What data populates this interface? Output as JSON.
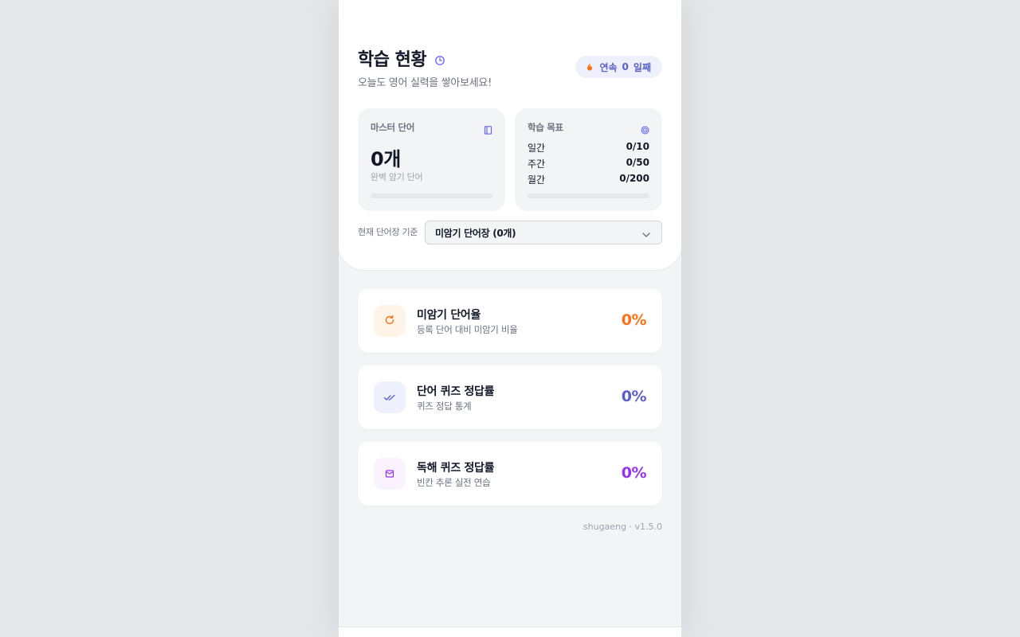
{
  "header": {
    "title": "학습 현황",
    "subtitle": "오늘도 영어 실력을 쌓아보세요!",
    "streak": {
      "label": "연속",
      "count": "0",
      "unit": "일째"
    }
  },
  "mastered": {
    "label": "마스터 단어",
    "value": "0개",
    "caption": "완벽 암기 단어",
    "progress": 0
  },
  "goals": {
    "label": "학습 목표",
    "rows": [
      {
        "name": "일간",
        "value": "0/10"
      },
      {
        "name": "주간",
        "value": "0/50"
      },
      {
        "name": "월간",
        "value": "0/200"
      }
    ],
    "progress": 0
  },
  "basis": {
    "label": "현재 단어장 기준",
    "selected": "미암기 단어장 (0개)"
  },
  "metrics": [
    {
      "title": "미암기 단어율",
      "desc": "등록 단어 대비 미암기 비율",
      "value": "0%",
      "color": "#f97316",
      "bg": "#fff4e8",
      "icon": "refresh-icon"
    },
    {
      "title": "단어 퀴즈 정답률",
      "desc": "퀴즈 정답 통계",
      "value": "0%",
      "color": "#5b5fc7",
      "bg": "#eef0fb",
      "icon": "double-check-icon"
    },
    {
      "title": "독해 퀴즈 정답률",
      "desc": "빈칸 추론 실전 연습",
      "value": "0%",
      "color": "#9333ea",
      "bg": "#faf2fd",
      "icon": "book-icon"
    }
  ],
  "footer": {
    "version": "shugaeng · v1.5.0"
  }
}
